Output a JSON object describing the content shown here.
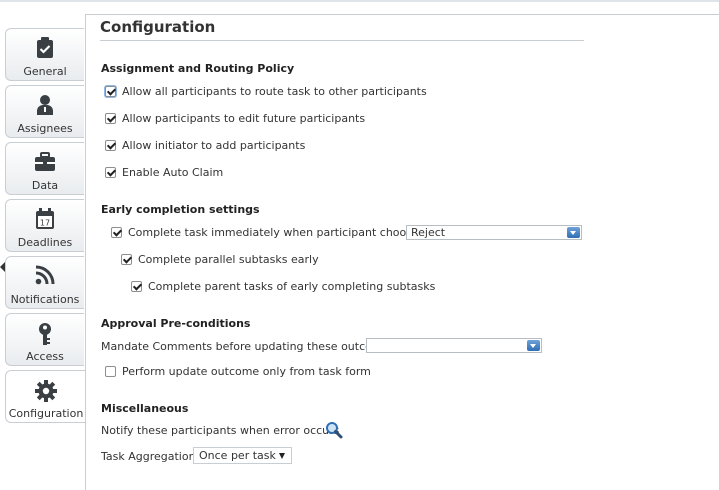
{
  "tabs": [
    {
      "label": "General",
      "icon": "clipboard-check-icon"
    },
    {
      "label": "Assignees",
      "icon": "person-icon"
    },
    {
      "label": "Data",
      "icon": "briefcase-icon"
    },
    {
      "label": "Deadlines",
      "icon": "calendar-icon",
      "calendar_day": "17"
    },
    {
      "label": "Notifications",
      "icon": "rss-icon"
    },
    {
      "label": "Access",
      "icon": "key-icon"
    },
    {
      "label": "Configuration",
      "icon": "gear-icon",
      "active": true
    }
  ],
  "page": {
    "title": "Configuration"
  },
  "assignment": {
    "heading": "Assignment and Routing Policy",
    "options": [
      {
        "label": "Allow all participants to route task to other participants",
        "checked": true
      },
      {
        "label": "Allow participants to edit future participants",
        "checked": true
      },
      {
        "label": "Allow initiator to add participants",
        "checked": true
      },
      {
        "label": "Enable Auto Claim",
        "checked": true
      }
    ]
  },
  "early_completion": {
    "heading": "Early completion settings",
    "complete_immediately": {
      "label": "Complete task immediately when participant chooses",
      "checked": true
    },
    "outcome_select": {
      "value": "Reject"
    },
    "parallel_subtasks": {
      "label": "Complete parallel subtasks early",
      "checked": true
    },
    "parent_tasks": {
      "label": "Complete parent tasks of early completing subtasks",
      "checked": true
    }
  },
  "approval": {
    "heading": "Approval Pre-conditions",
    "mandate_comments_label": "Mandate Comments before updating these outcomes",
    "mandate_select": {
      "value": ""
    },
    "update_from_form": {
      "label": "Perform update outcome only from task form",
      "checked": false
    }
  },
  "misc": {
    "heading": "Miscellaneous",
    "notify_label": "Notify these participants when error occurs",
    "aggregation_label": "Task Aggregation",
    "aggregation_value": "Once per task"
  },
  "colors": {
    "accent": "#2f6fb5",
    "tab_border": "#c9ced3"
  }
}
